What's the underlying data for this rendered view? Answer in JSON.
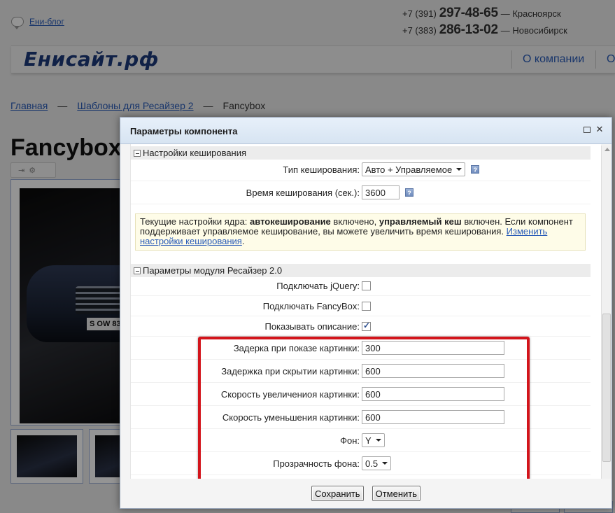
{
  "site": {
    "blog_link": "Ени-блог",
    "phones": [
      {
        "code": "+7 (391)",
        "number": "297-48-65",
        "city": "— Красноярск"
      },
      {
        "code": "+7 (383)",
        "number": "286-13-02",
        "city": "— Новосибирск"
      }
    ],
    "logo": "Енисайт.рф",
    "nav": [
      "О компании",
      "О"
    ],
    "breadcrumb": {
      "home": "Главная",
      "sep": "—",
      "section": "Шаблоны для Ресайзер 2",
      "current": "Fancybox"
    },
    "page_title": "Fancybox",
    "photo_plate": "S OW 83"
  },
  "dialog": {
    "title": "Параметры компонента",
    "sections": {
      "caching": {
        "title": "Настройки кеширования",
        "cache_type_label": "Тип кеширования:",
        "cache_type_value": "Авто + Управляемое",
        "cache_time_label": "Время кеширования (сек.):",
        "cache_time_value": "3600",
        "notice_prefix": "Текущие настройки ядра: ",
        "notice_bold1": "автокеширование",
        "notice_mid1": " включено, ",
        "notice_bold2": "управляемый кеш",
        "notice_mid2": " включен. Если компонент поддерживает управляемое кеширование, вы можете увеличить время кеширования. ",
        "notice_link": "Изменить настройки кеширования",
        "notice_end": "."
      },
      "resizer": {
        "title": "Параметры модуля Ресайзер 2.0",
        "jquery_label": "Подключать jQuery:",
        "fancybox_label": "Подключать FancyBox:",
        "show_desc_label": "Показывать описание:",
        "show_delay_label": "Задерка при показе картинки:",
        "show_delay_value": "300",
        "hide_delay_label": "Задержка при скрытии картинки:",
        "hide_delay_value": "600",
        "zoom_in_label": "Скорость увеличениоя картинки:",
        "zoom_in_value": "600",
        "zoom_out_label": "Скорость уменьшения картинки:",
        "zoom_out_value": "600",
        "bg_label": "Фон:",
        "bg_value": "Y",
        "bg_opacity_label": "Прозрачность фона:",
        "bg_opacity_value": "0.5"
      }
    },
    "checkbox_states": {
      "jquery": false,
      "fancybox": false,
      "show_desc": true
    },
    "help_glyph": "?",
    "save_label": "Сохранить",
    "cancel_label": "Отменить",
    "close_glyph": "✕"
  },
  "colors": {
    "highlight": "#d3141b",
    "link": "#2a5cb8",
    "logo": "#1c3a7a"
  }
}
